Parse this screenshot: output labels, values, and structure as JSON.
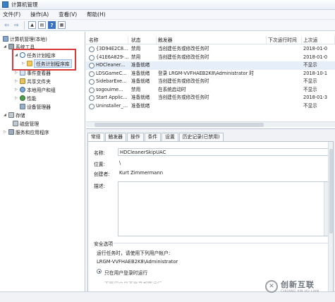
{
  "window": {
    "title": "计算机管理"
  },
  "menu": [
    "文件(F)",
    "操作(A)",
    "查看(V)",
    "帮助(H)"
  ],
  "toolbar": {
    "back": "⇦",
    "forward": "⇨",
    "help": "?"
  },
  "tree": {
    "root": "计算机管理(本地)",
    "system_tools": "系统工具",
    "task_scheduler": "任务计划程序",
    "task_scheduler_library": "任务计划程序库",
    "event_viewer": "事件查看器",
    "shared_folders": "共享文件夹",
    "local_users": "本地用户和组",
    "performance": "性能",
    "device_manager": "设备管理器",
    "storage": "存储",
    "disk_management": "磁盘管理",
    "services": "服务和应用程序"
  },
  "task_list": {
    "columns": [
      "名称",
      "状态",
      "触发器",
      "下次运行时间",
      "上次运"
    ],
    "rows": [
      {
        "name": "{3D94E2C8...",
        "status": "禁用",
        "trigger": "当创建任务或修改任务时",
        "next": "",
        "last": "2018-01-0"
      },
      {
        "name": "{41E6A829-...",
        "status": "禁用",
        "trigger": "当创建任务或修改任务时",
        "next": "",
        "last": "2018-01-0"
      },
      {
        "name": "HDCleaner...",
        "status": "准备就绪",
        "trigger": "",
        "next": "",
        "last": "不显示"
      },
      {
        "name": "LDSGameC...",
        "status": "准备就绪",
        "trigger": "登录 LRGM-VVFHAEB2K8\\Administrator 时",
        "next": "",
        "last": "2018-10-1"
      },
      {
        "name": "SidebarExe...",
        "status": "准备就绪",
        "trigger": "当创建任务或修改任务时",
        "next": "",
        "last": "不显示"
      },
      {
        "name": "sogouime...",
        "status": "禁用",
        "trigger": "在系统启动时",
        "next": "",
        "last": "不显示"
      },
      {
        "name": "Start Applic...",
        "status": "准备就绪",
        "trigger": "当创建任务或修改任务时",
        "next": "",
        "last": "2018-01-3"
      },
      {
        "name": "Uninstaller_...",
        "status": "准备就绪",
        "trigger": "",
        "next": "",
        "last": "不显示"
      }
    ]
  },
  "detail": {
    "tabs": [
      "常规",
      "触发器",
      "操作",
      "条件",
      "设置",
      "历史记录(已禁用)"
    ],
    "name_label": "名称:",
    "name_value": "HDCleanerSkipUAC",
    "location_label": "位置:",
    "location_value": "\\",
    "author_label": "创建者:",
    "author_value": "Kurt Zimmermann",
    "description_label": "描述:",
    "security_title": "安全选项",
    "run_as_prompt": "运行任务时，请使用下列用户帐户:",
    "run_as_user": "LRGM-VVFHAEB2K8\\Administrator",
    "radio_logged_on": "只在用户登录时运行",
    "radio_partial": "不管用户是否登录都要运行"
  },
  "watermark": {
    "logo": "✕",
    "text": "创新互联",
    "sub": "CHUANG XIN HU LIAN"
  }
}
